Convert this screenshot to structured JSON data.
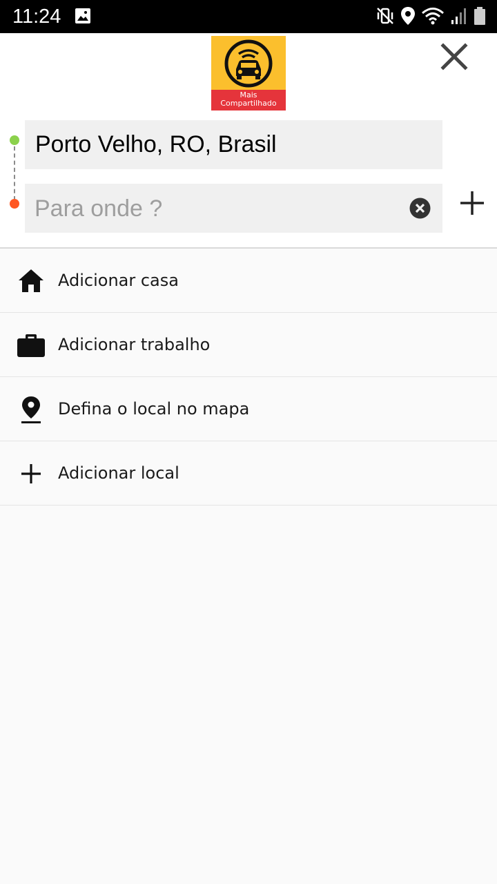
{
  "status_bar": {
    "time": "11:24",
    "icons": [
      "gallery-icon",
      "mute-vibrate-icon",
      "location-icon",
      "wifi-icon",
      "signal-icon",
      "battery-icon"
    ]
  },
  "header": {
    "logo": {
      "text_line1": "Mais",
      "text_line2": "Compartilhado",
      "colors": {
        "top": "#fbbf2d",
        "bottom": "#e5343b"
      }
    },
    "close_icon": "close-icon",
    "origin": {
      "value": "Porto Velho, RO, Brasil",
      "dot_color": "#8bd14c"
    },
    "destination": {
      "value": "",
      "placeholder": "Para onde ?",
      "dot_color": "#ff5722"
    },
    "add_stop_icon": "plus-icon"
  },
  "list": {
    "items": [
      {
        "icon": "home-icon",
        "label": "Adicionar casa"
      },
      {
        "icon": "briefcase-icon",
        "label": "Adicionar trabalho"
      },
      {
        "icon": "map-pin-icon",
        "label": "Defina o local no mapa"
      },
      {
        "icon": "plus-icon",
        "label": "Adicionar local"
      }
    ]
  }
}
